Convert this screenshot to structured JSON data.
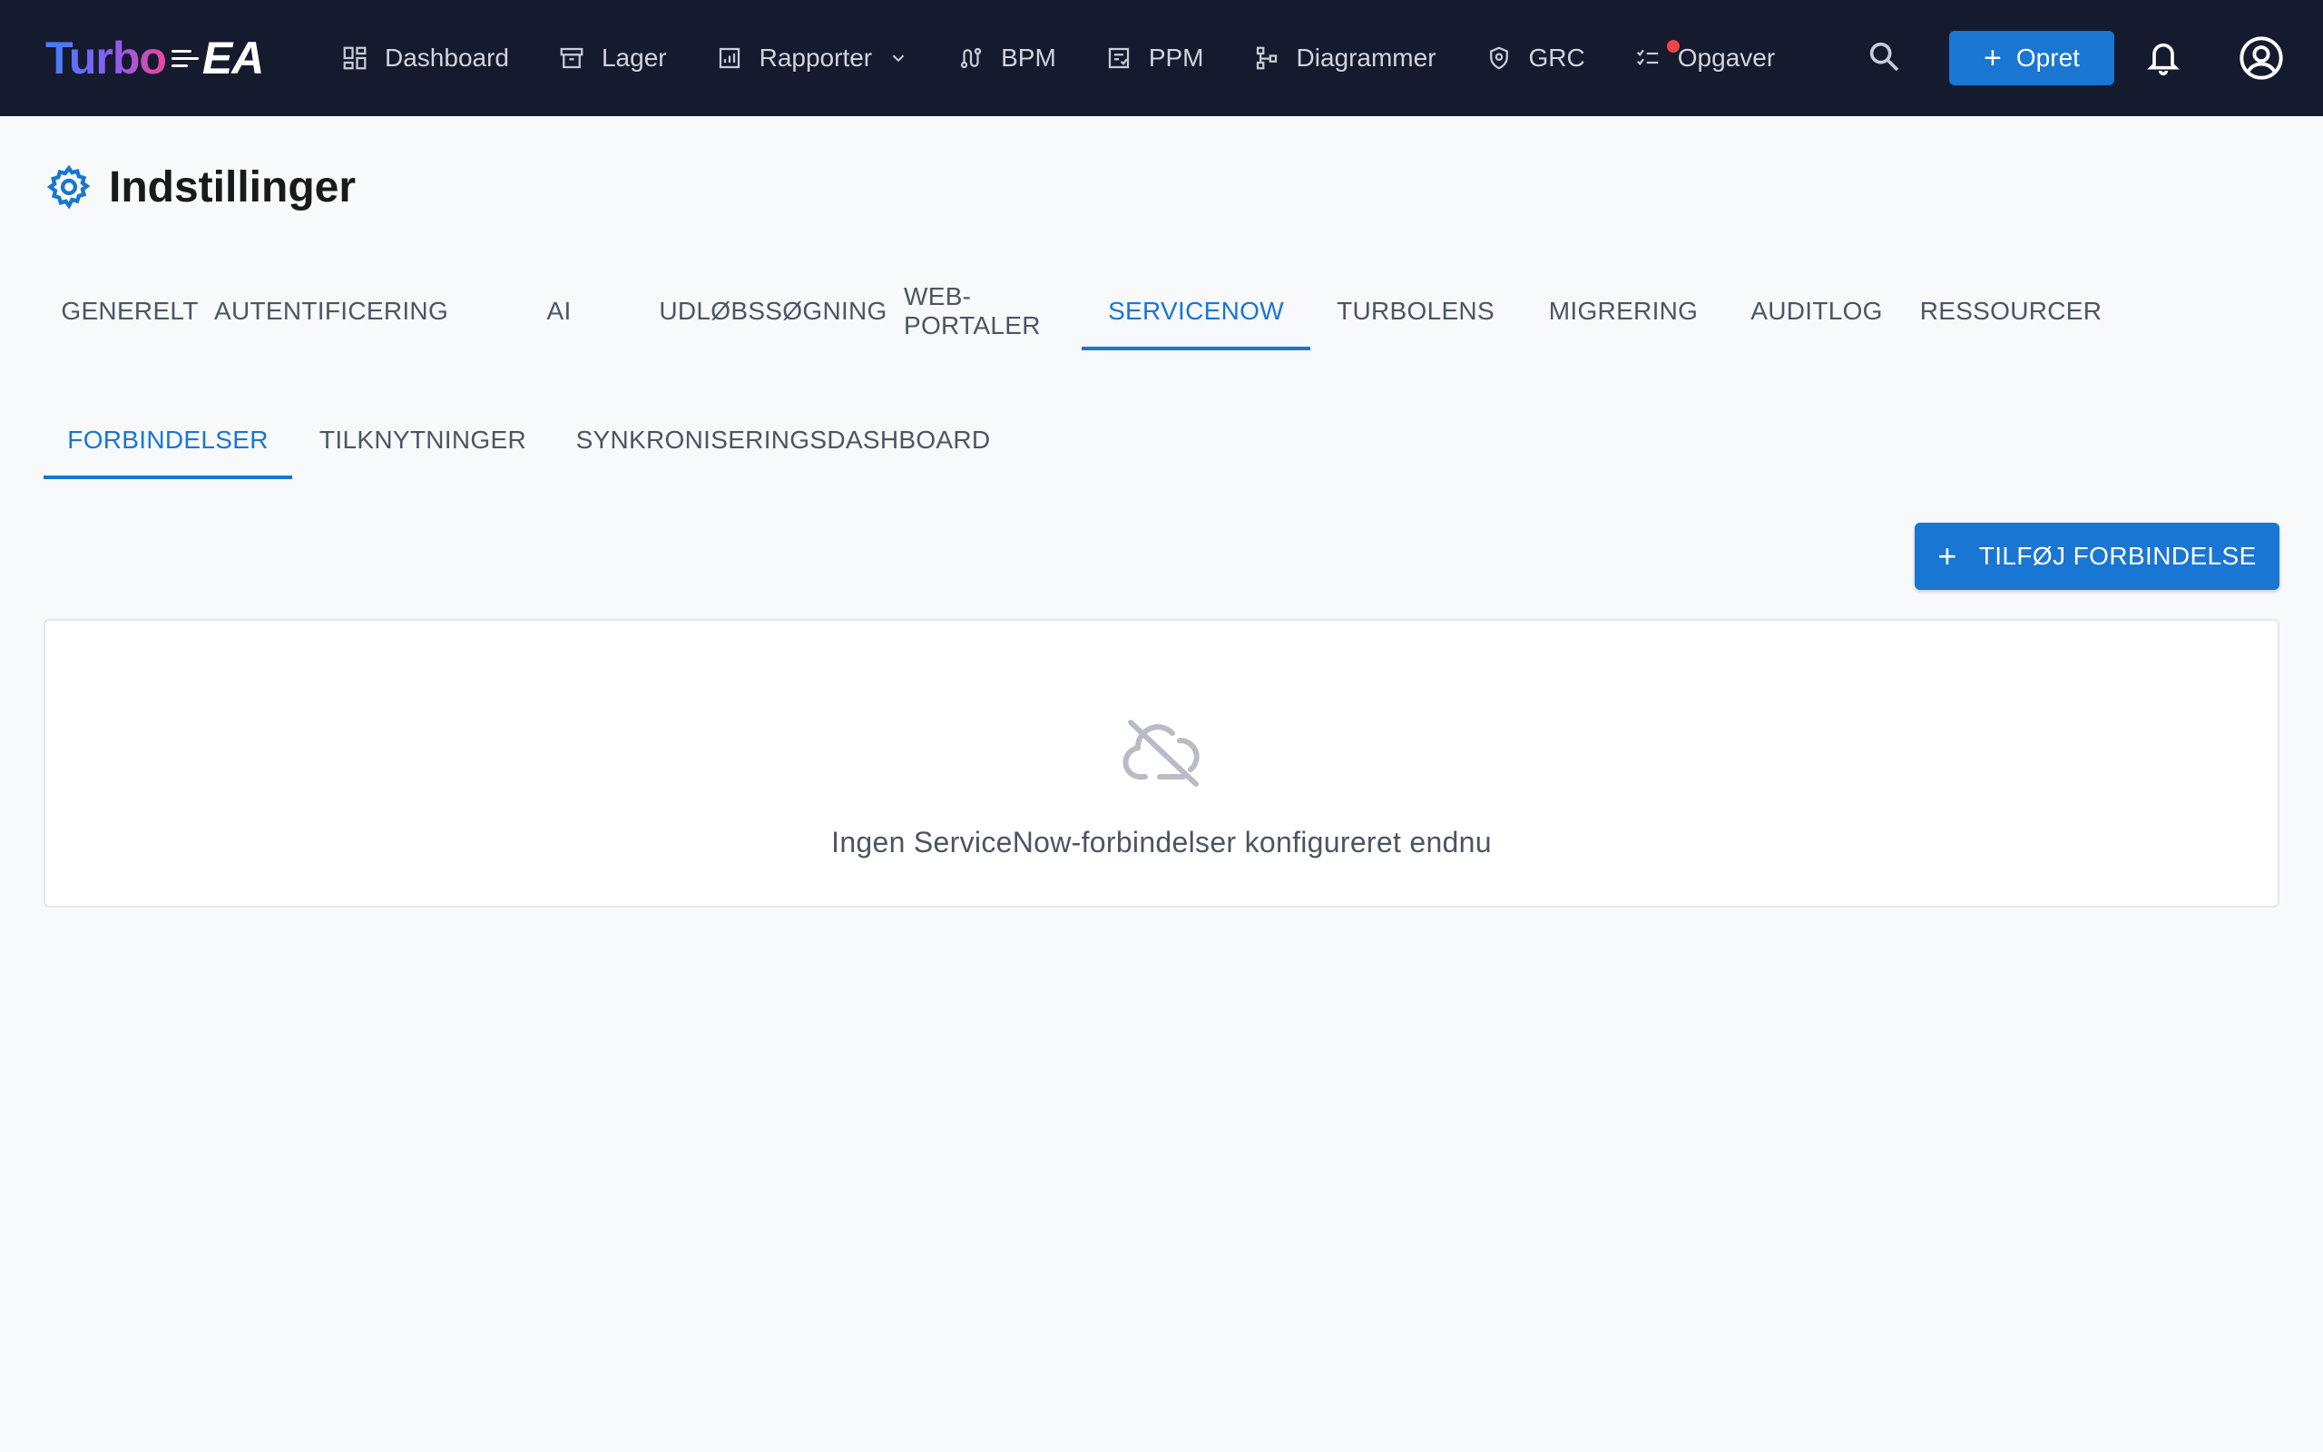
{
  "app": {
    "logo_turbo": "Turbo",
    "logo_ea": "EA"
  },
  "nav": {
    "items": [
      {
        "label": "Dashboard",
        "icon": "dashboard-icon"
      },
      {
        "label": "Lager",
        "icon": "archive-icon"
      },
      {
        "label": "Rapporter",
        "icon": "report-icon"
      },
      {
        "label": "BPM",
        "icon": "process-icon"
      },
      {
        "label": "PPM",
        "icon": "project-icon"
      },
      {
        "label": "Diagrammer",
        "icon": "diagram-icon"
      },
      {
        "label": "GRC",
        "icon": "shield-icon"
      },
      {
        "label": "Opgaver",
        "icon": "tasks-icon"
      }
    ],
    "create_label": "Opret"
  },
  "page": {
    "title": "Indstillinger"
  },
  "tabs": [
    "GENERELT",
    "AUTENTIFICERING",
    "AI",
    "UDLØBSSØGNING",
    "WEB-PORTALER",
    "SERVICENOW",
    "TURBOLENS",
    "MIGRERING",
    "AUDITLOG",
    "RESSOURCER"
  ],
  "active_tab": "SERVICENOW",
  "subtabs": [
    "FORBINDELSER",
    "TILKNYTNINGER",
    "SYNKRONISERINGSDASHBOARD"
  ],
  "active_subtab": "FORBINDELSER",
  "connections": {
    "add_button_label": "TILFØJ FORBINDELSE",
    "empty_message": "Ingen ServiceNow-forbindelser konfigureret endnu"
  },
  "colors": {
    "topbar": "#161a2e",
    "accent": "#1976d2",
    "notification_dot": "#ef4444"
  }
}
